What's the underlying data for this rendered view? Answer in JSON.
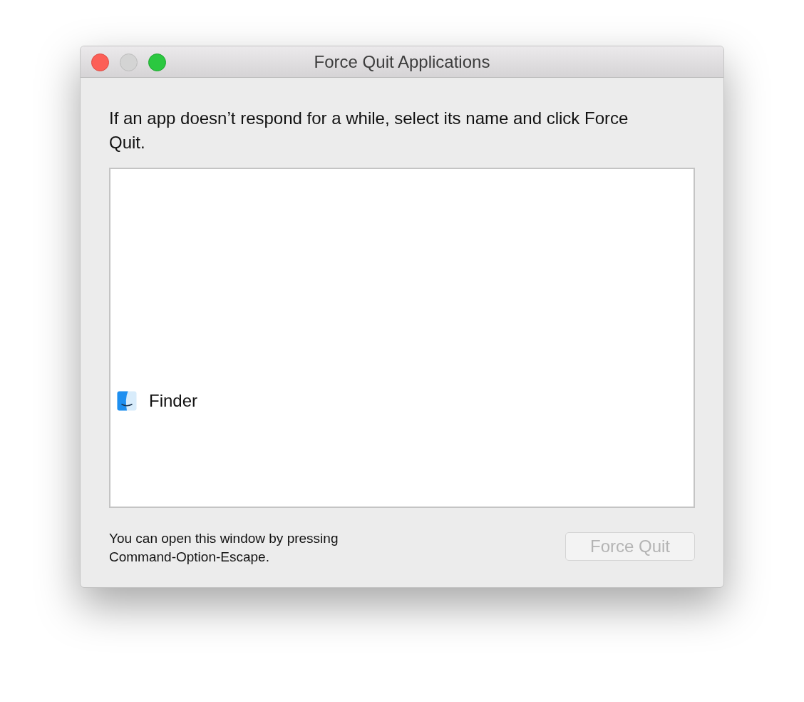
{
  "window": {
    "title": "Force Quit Applications",
    "controls": [
      {
        "kind": "close",
        "disabled": false
      },
      {
        "kind": "minimize",
        "disabled": true
      },
      {
        "kind": "zoom",
        "disabled": false
      }
    ]
  },
  "instructions": "If an app doesn’t respond for a while, select its name and click Force Quit.",
  "apps": [
    {
      "name": "Finder",
      "selected": false
    }
  ],
  "hint": "You can open this window by pressing Command-Option-Escape.",
  "button": {
    "label": "Force Quit",
    "disabled": true
  }
}
